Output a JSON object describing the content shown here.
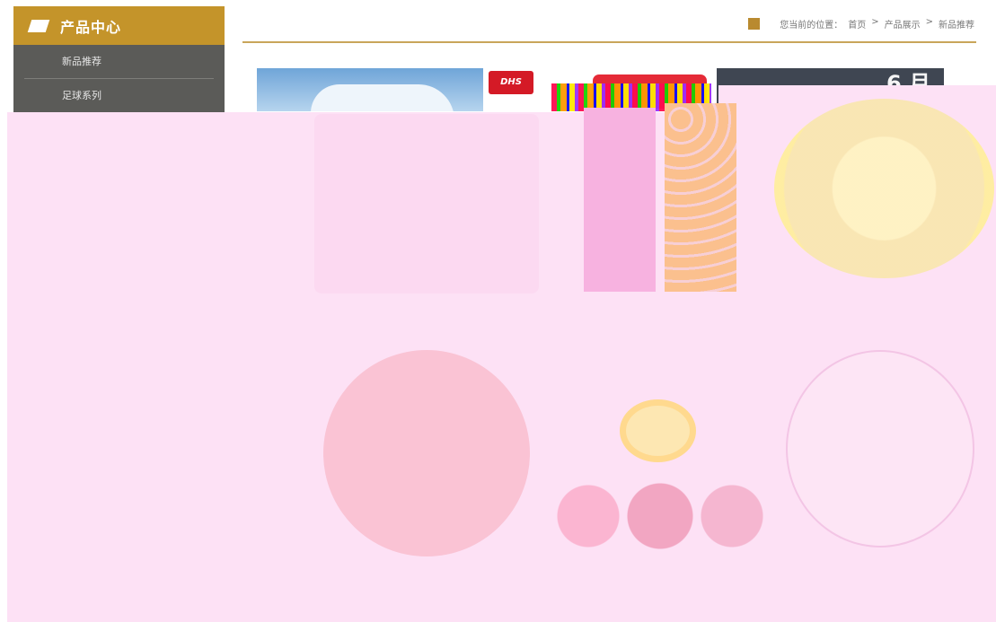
{
  "sidebar": {
    "title": "产品中心",
    "items": [
      {
        "label": "新品推荐"
      },
      {
        "label": "足球系列"
      }
    ]
  },
  "breadcrumb": {
    "prefix": "您当前的位置：",
    "items": [
      {
        "label": "首页"
      },
      {
        "label": "产品展示"
      },
      {
        "label": "新品推荐"
      }
    ],
    "separator": ">"
  },
  "products": {
    "third_partial_mark": "6 月"
  },
  "colors": {
    "sidebar_head": "#c4942a",
    "sidebar_body": "#5b5b58",
    "accent_line": "#c9a55a",
    "overlay": "#fde1f5"
  }
}
